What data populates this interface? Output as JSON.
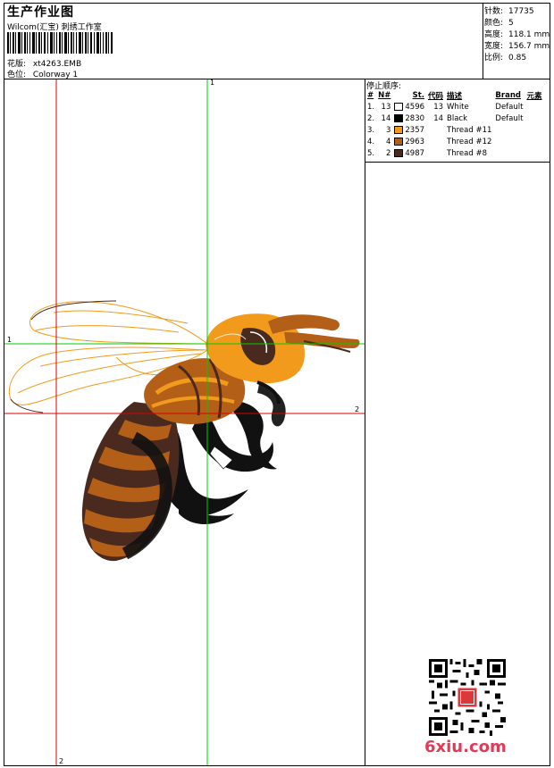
{
  "header": {
    "title": "生产作业图",
    "subtitle": "Wilcom(汇宝) 刺绣工作室",
    "design_label": "花版:",
    "design_value": "xt4263.EMB",
    "color_label": "色位:",
    "color_value": "Colorway 1"
  },
  "info": [
    {
      "label": "针数:",
      "value": "17735"
    },
    {
      "label": "颜色:",
      "value": "5"
    },
    {
      "label": "高度:",
      "value": "118.1 mm"
    },
    {
      "label": "宽度:",
      "value": "156.7 mm"
    },
    {
      "label": "比例:",
      "value": "0.85"
    }
  ],
  "stop_sequence": {
    "title": "停止顺序:",
    "columns": [
      "#",
      "N#",
      "St.",
      "代码",
      "描述",
      "Brand",
      "元素"
    ],
    "rows": [
      {
        "idx": "1.",
        "n": "13",
        "color": "#ffffff",
        "st": "4596",
        "code": "13",
        "desc": "White",
        "brand": "Default",
        "elem": ""
      },
      {
        "idx": "2.",
        "n": "14",
        "color": "#000000",
        "st": "2830",
        "code": "14",
        "desc": "Black",
        "brand": "Default",
        "elem": ""
      },
      {
        "idx": "3.",
        "n": "3",
        "color": "#f29a1c",
        "st": "2357",
        "code": "",
        "desc": "Thread #11",
        "brand": "",
        "elem": ""
      },
      {
        "idx": "4.",
        "n": "4",
        "color": "#b35f18",
        "st": "2963",
        "code": "",
        "desc": "Thread #12",
        "brand": "",
        "elem": ""
      },
      {
        "idx": "5.",
        "n": "2",
        "color": "#4a2a1e",
        "st": "4987",
        "code": "",
        "desc": "Thread #8",
        "brand": "",
        "elem": ""
      }
    ]
  },
  "axes": {
    "green_label_top": "1",
    "green_label_left": "1",
    "red_label_right": "2",
    "red_label_bottom": "2",
    "green_color": "#00cc00",
    "red_color": "#dd0000"
  },
  "watermark": "6xiu.com"
}
